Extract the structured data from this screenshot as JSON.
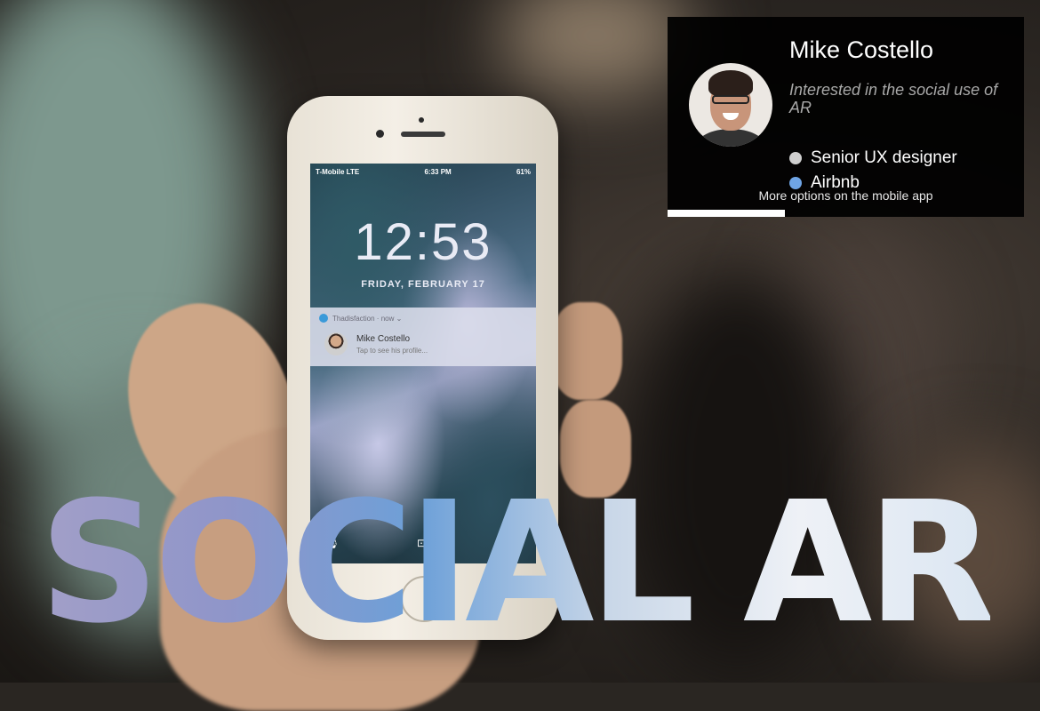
{
  "phone": {
    "carrier": "T-Mobile  LTE",
    "status_time": "6:33 PM",
    "battery": "61%",
    "clock": "12:53",
    "date": "FRIDAY, FEBRUARY 17",
    "notification": {
      "app": "Thadisfaction · now ⌄",
      "name": "Mike Costello",
      "text": "Tap to see his profile..."
    }
  },
  "title": "SOCIAL AR",
  "card": {
    "name": "Mike Costello",
    "tagline": "Interested in the social use of AR",
    "details": [
      {
        "label": "Senior UX designer",
        "color": "#cfcfcf"
      },
      {
        "label": "Airbnb",
        "color": "#6fa5e6"
      }
    ],
    "footer": "More options on the mobile app",
    "progress": 0.33
  },
  "icons": [
    "mic-icon",
    "lock-icon",
    "camera-icon",
    "avatar"
  ]
}
